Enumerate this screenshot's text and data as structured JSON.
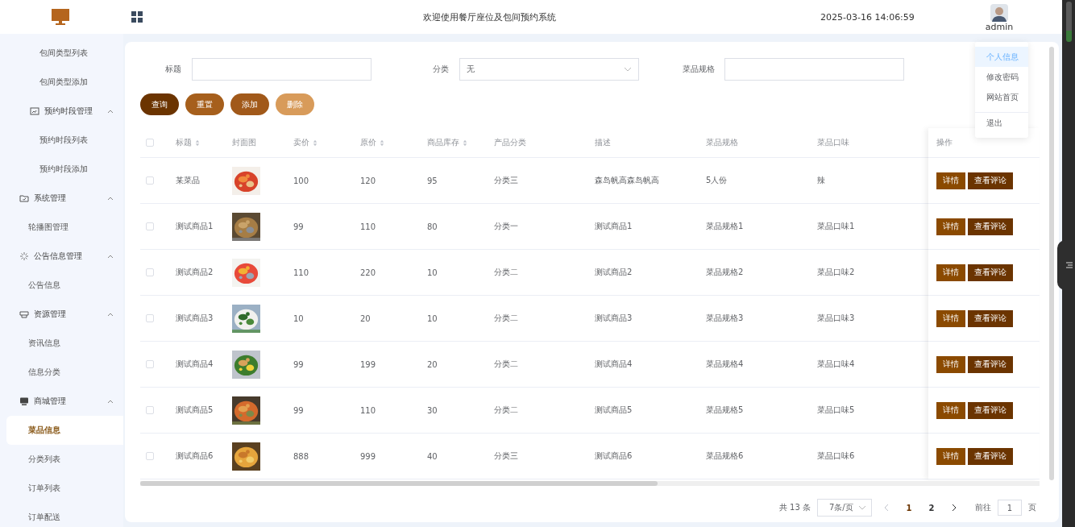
{
  "header": {
    "title": "欢迎使用餐厅座位及包间预约系统",
    "datetime": "2025-03-16 14:06:59",
    "user": "admin"
  },
  "user_menu": {
    "items": [
      {
        "label": "个人信息",
        "highlighted": true,
        "divided": false
      },
      {
        "label": "修改密码",
        "highlighted": false,
        "divided": false
      },
      {
        "label": "网站首页",
        "highlighted": false,
        "divided": false
      },
      {
        "label": "退出",
        "highlighted": false,
        "divided": true
      }
    ]
  },
  "sidebar": {
    "scrolled_group": {
      "children": [
        {
          "label": "包间类型列表",
          "selected": false
        },
        {
          "label": "包间类型添加",
          "selected": false
        },
        {
          "label": "预约时段管理",
          "expanded": true,
          "children": [
            {
              "label": "预约时段列表",
              "selected": false
            },
            {
              "label": "预约时段添加",
              "selected": false
            }
          ]
        }
      ]
    },
    "groups": [
      {
        "label": "系统管理",
        "expanded": true,
        "children": [
          {
            "label": "轮播图管理",
            "selected": false
          }
        ]
      },
      {
        "label": "公告信息管理",
        "expanded": true,
        "children": [
          {
            "label": "公告信息",
            "selected": false
          }
        ]
      },
      {
        "label": "资源管理",
        "expanded": true,
        "children": [
          {
            "label": "资讯信息",
            "selected": false
          },
          {
            "label": "信息分类",
            "selected": false
          }
        ]
      },
      {
        "label": "商城管理",
        "expanded": true,
        "children": [
          {
            "label": "菜品信息",
            "selected": true
          },
          {
            "label": "分类列表",
            "selected": false
          },
          {
            "label": "订单列表",
            "selected": false
          },
          {
            "label": "订单配送",
            "selected": false
          }
        ]
      }
    ]
  },
  "filters": [
    {
      "label": "标题",
      "kind": "text"
    },
    {
      "label": "分类",
      "kind": "select",
      "value": "无"
    },
    {
      "label": "菜品规格",
      "kind": "text"
    }
  ],
  "buttons": [
    {
      "label": "查询",
      "color": "#6b3400"
    },
    {
      "label": "重置",
      "color": "#a65f1c"
    },
    {
      "label": "添加",
      "color": "#a1591a"
    },
    {
      "label": "删除",
      "color": "#d89b5a"
    }
  ],
  "table": {
    "select_all": {
      "checked": false
    },
    "columns": [
      {
        "label": "标题",
        "kind": "text",
        "sortable": true
      },
      {
        "label": "封面图",
        "sortable": false
      },
      {
        "label": "卖价",
        "kind": "text",
        "sortable": true
      },
      {
        "label": "原价",
        "kind": "text",
        "sortable": true
      },
      {
        "label": "商品库存",
        "kind": "text",
        "sortable": true
      },
      {
        "label": "产品分类",
        "kind": "text",
        "sortable": false
      },
      {
        "label": "描述",
        "kind": "text",
        "sortable": false
      },
      {
        "label": "菜品规格",
        "kind": "text",
        "sortable": false
      },
      {
        "label": "菜品口味",
        "kind": "text",
        "sortable": false
      },
      {
        "label": "操作",
        "kind": "actions",
        "sortable": false
      }
    ],
    "rows": [
      {
        "checked": false,
        "cells": [
          "某菜品",
          "",
          "100",
          "120",
          "95",
          "分类三",
          "森岛帆高森岛帆高",
          "5人份",
          "辣"
        ],
        "actions": [
          "详情",
          "查看评论"
        ]
      },
      {
        "checked": false,
        "cells": [
          "测试商品1",
          "",
          "99",
          "110",
          "80",
          "分类一",
          "测试商品1",
          "菜品规格1",
          "菜品口味1"
        ],
        "actions": [
          "详情",
          "查看评论"
        ]
      },
      {
        "checked": false,
        "cells": [
          "测试商品2",
          "",
          "110",
          "220",
          "10",
          "分类二",
          "测试商品2",
          "菜品规格2",
          "菜品口味2"
        ],
        "actions": [
          "详情",
          "查看评论"
        ]
      },
      {
        "checked": false,
        "cells": [
          "测试商品3",
          "",
          "10",
          "20",
          "10",
          "分类二",
          "测试商品3",
          "菜品规格3",
          "菜品口味3"
        ],
        "actions": [
          "详情",
          "查看评论"
        ]
      },
      {
        "checked": false,
        "cells": [
          "测试商品4",
          "",
          "99",
          "199",
          "20",
          "分类二",
          "测试商品4",
          "菜品规格4",
          "菜品口味4"
        ],
        "actions": [
          "详情",
          "查看评论"
        ]
      },
      {
        "checked": false,
        "cells": [
          "测试商品5",
          "",
          "99",
          "110",
          "30",
          "分类二",
          "测试商品5",
          "菜品规格5",
          "菜品口味5"
        ],
        "actions": [
          "详情",
          "查看评论"
        ]
      },
      {
        "checked": false,
        "cells": [
          "测试商品6",
          "",
          "888",
          "999",
          "40",
          "分类三",
          "测试商品6",
          "菜品规格6",
          "菜品口味6"
        ],
        "actions": [
          "详情",
          "查看评论"
        ]
      }
    ]
  },
  "pagination": {
    "total": "共 13 条",
    "page_size": "7条/页",
    "prev_disabled": true,
    "next_disabled": false,
    "pages": [
      {
        "label": "1",
        "selected": true
      },
      {
        "label": "2",
        "selected": false
      }
    ],
    "goto_label": "前往",
    "goto_value": "1",
    "goto_suffix": "页"
  }
}
